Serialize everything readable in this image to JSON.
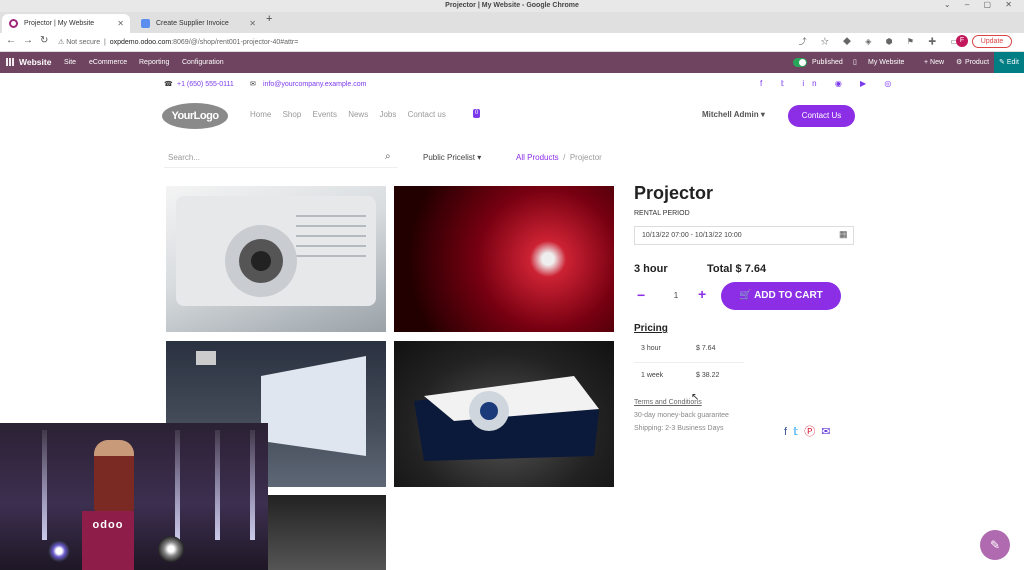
{
  "window": {
    "title": "Projector | My Website - Google Chrome"
  },
  "tabs": [
    {
      "label": "Projector | My Website"
    },
    {
      "label": "Create Supplier Invoice"
    }
  ],
  "address": {
    "security": "Not secure",
    "domain": "oxpdemo.odoo.com",
    "path": ":8069/@/shop/rent001-projector-40#attr="
  },
  "browser": {
    "profile_initial": "F",
    "update_label": "Update"
  },
  "admin_bar": {
    "brand": "Website",
    "menus": [
      "Site",
      "eCommerce",
      "Reporting",
      "Configuration"
    ],
    "published": "Published",
    "my_website": "My Website",
    "new": "+ New",
    "product": "Product",
    "edit": "Edit"
  },
  "header": {
    "phone": "+1 (650) 555-0111",
    "email": "info@yourcompany.example.com",
    "logo": "YourLogo",
    "nav": [
      "Home",
      "Shop",
      "Events",
      "News",
      "Jobs",
      "Contact us"
    ],
    "cart_count": "0",
    "user": "Mitchell Admin",
    "contact_button": "Contact Us"
  },
  "shop": {
    "search_placeholder": "Search...",
    "pricelist": "Public Pricelist",
    "breadcrumb_root": "All Products",
    "breadcrumb_current": "Projector"
  },
  "product": {
    "name": "Projector",
    "rental_period_label": "RENTAL PERIOD",
    "rental_period_value": "10/13/22 07:00 - 10/13/22 10:00",
    "duration": "3 hour",
    "total": "Total $ 7.64",
    "quantity": "1",
    "add_to_cart": "ADD TO CART",
    "pricing_heading": "Pricing",
    "pricing": [
      {
        "period": "3 hour",
        "price": "$ 7.64"
      },
      {
        "period": "1 week",
        "price": "$ 38.22"
      }
    ],
    "terms": "Terms and Conditions",
    "guarantee": "30-day money-back guarantee",
    "shipping": "Shipping: 2-3 Business Days"
  },
  "webcam": {
    "lectern_text": "odoo"
  },
  "colors": {
    "admin_bar": "#6f4460",
    "accent": "#8b2ee6",
    "edit": "#017e84"
  }
}
